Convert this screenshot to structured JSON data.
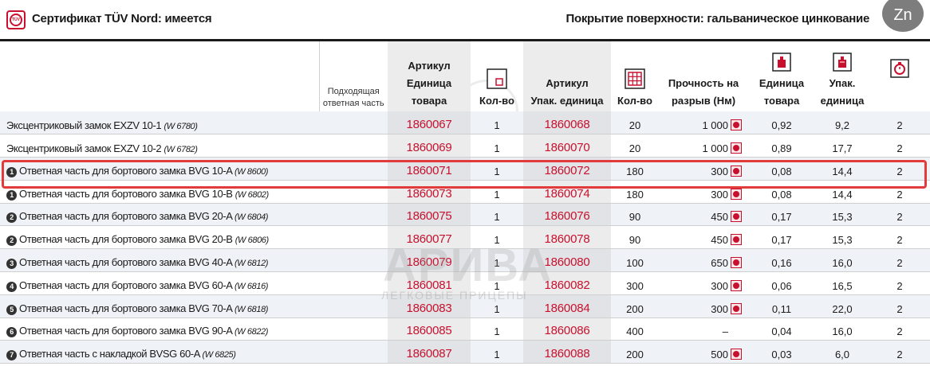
{
  "header": {
    "certificate": "Сертификат TÜV Nord: имеется",
    "coating": "Покрытие поверхности: гальваническое цинкование",
    "zn_badge": "Zn",
    "tuv_icon_label": "TÜV"
  },
  "columns": {
    "fit_line1": "Подходящая",
    "fit_line2": "ответная часть",
    "article_unit_l1": "Артикул",
    "article_unit_l2": "Единица",
    "article_unit_l3": "товара",
    "qty1": "Кол-во",
    "article_pack_l1": "Артикул",
    "article_pack_l2": "Упак. единица",
    "qty2": "Кол-во",
    "strength_l1": "Прочность на",
    "strength_l2": "разрыв (Нм)",
    "weight_unit_l1": "Единица",
    "weight_unit_l2": "товара",
    "weight_pack_l1": "Упак.",
    "weight_pack_l2": "единица"
  },
  "rows": [
    {
      "badge": "",
      "name": "Эксцентриковый замок EXZV 10-1",
      "w": "(W 6780)",
      "art1": "1860067",
      "qty1": "1",
      "art2": "1860068",
      "qty2": "20",
      "strength": "1 000",
      "wu": "0,92",
      "wp": "9,2",
      "last": "2"
    },
    {
      "badge": "",
      "name": "Эксцентриковый замок EXZV 10-2",
      "w": "(W 6782)",
      "art1": "1860069",
      "qty1": "1",
      "art2": "1860070",
      "qty2": "20",
      "strength": "1 000",
      "wu": "0,89",
      "wp": "17,7",
      "last": "2"
    },
    {
      "badge": "1",
      "name": "Ответная часть для бортового замка BVG 10-A",
      "w": "(W 8600)",
      "art1": "1860071",
      "qty1": "1",
      "art2": "1860072",
      "qty2": "180",
      "strength": "300",
      "wu": "0,08",
      "wp": "14,4",
      "last": "2"
    },
    {
      "badge": "1",
      "name": "Ответная часть для бортового замка BVG 10-B",
      "w": "(W 6802)",
      "art1": "1860073",
      "qty1": "1",
      "art2": "1860074",
      "qty2": "180",
      "strength": "300",
      "wu": "0,08",
      "wp": "14,4",
      "last": "2"
    },
    {
      "badge": "2",
      "name": "Ответная часть для бортового замка BVG 20-A",
      "w": "(W 6804)",
      "art1": "1860075",
      "qty1": "1",
      "art2": "1860076",
      "qty2": "90",
      "strength": "450",
      "wu": "0,17",
      "wp": "15,3",
      "last": "2"
    },
    {
      "badge": "2",
      "name": "Ответная часть для бортового замка BVG 20-B",
      "w": "(W 6806)",
      "art1": "1860077",
      "qty1": "1",
      "art2": "1860078",
      "qty2": "90",
      "strength": "450",
      "wu": "0,17",
      "wp": "15,3",
      "last": "2"
    },
    {
      "badge": "3",
      "name": "Ответная часть для бортового замка BVG 40-A",
      "w": "(W 6812)",
      "art1": "1860079",
      "qty1": "1",
      "art2": "1860080",
      "qty2": "100",
      "strength": "650",
      "wu": "0,16",
      "wp": "16,0",
      "last": "2"
    },
    {
      "badge": "4",
      "name": "Ответная часть для бортового замка BVG 60-A",
      "w": "(W 6816)",
      "art1": "1860081",
      "qty1": "1",
      "art2": "1860082",
      "qty2": "300",
      "strength": "300",
      "wu": "0,06",
      "wp": "16,5",
      "last": "2"
    },
    {
      "badge": "5",
      "name": "Ответная часть для бортового замка BVG 70-A",
      "w": "(W 6818)",
      "art1": "1860083",
      "qty1": "1",
      "art2": "1860084",
      "qty2": "200",
      "strength": "300",
      "wu": "0,11",
      "wp": "22,0",
      "last": "2"
    },
    {
      "badge": "6",
      "name": "Ответная часть для бортового замка BVG 90-A",
      "w": "(W 6822)",
      "art1": "1860085",
      "qty1": "1",
      "art2": "1860086",
      "qty2": "400",
      "strength": "–",
      "wu": "0,04",
      "wp": "16,0",
      "last": "2"
    },
    {
      "badge": "7",
      "name": "Ответная часть с накладкой BVSG 60-A",
      "w": "(W 6825)",
      "art1": "1860087",
      "qty1": "1",
      "art2": "1860088",
      "qty2": "200",
      "strength": "500",
      "wu": "0,03",
      "wp": "6,0",
      "last": "2"
    }
  ],
  "watermark": {
    "brand": "АРИВА",
    "sub": "ЛЕГКОВЫЕ ПРИЦЕПЫ"
  },
  "colors": {
    "article_red": "#c8102e",
    "highlight": "#e23b3b",
    "zn_badge": "#7d7d7d"
  }
}
